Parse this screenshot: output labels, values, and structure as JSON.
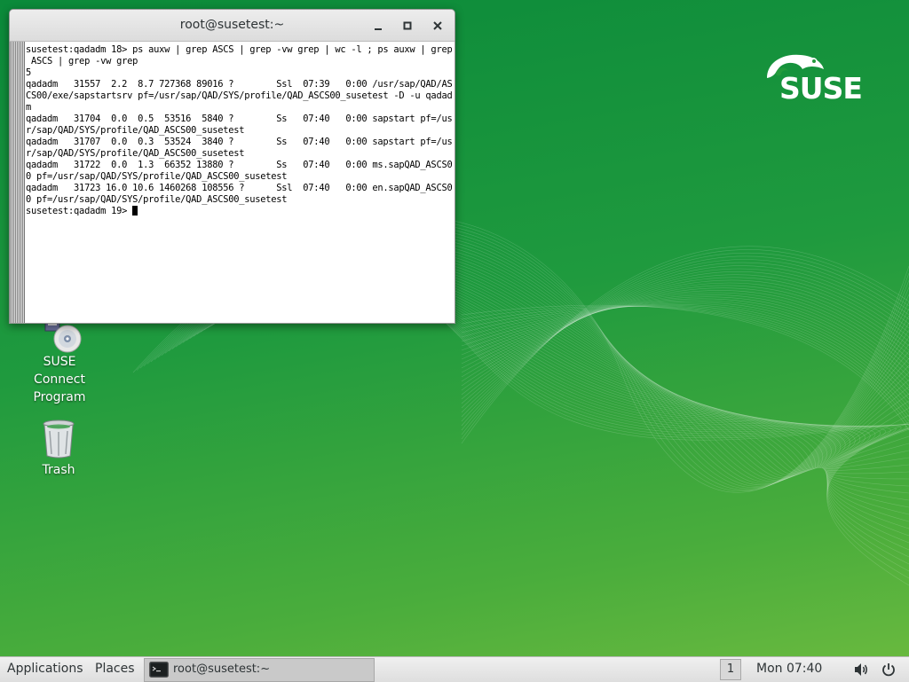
{
  "desktop": {
    "logo_text": "SUSE",
    "icons": [
      {
        "label_lines": [
          "SUSE",
          "Connect",
          "Program"
        ],
        "icon": "disk-icon"
      },
      {
        "label_lines": [
          "Trash"
        ],
        "icon": "trash-icon"
      }
    ]
  },
  "terminal": {
    "title": "root@susetest:~",
    "lines": [
      "susetest:qadadm 18> ps auxw | grep ASCS | grep -vw grep | wc -l ; ps auxw | grep",
      " ASCS | grep -vw grep",
      "5",
      "qadadm   31557  2.2  8.7 727368 89016 ?        Ssl  07:39   0:00 /usr/sap/QAD/AS",
      "CS00/exe/sapstartsrv pf=/usr/sap/QAD/SYS/profile/QAD_ASCS00_susetest -D -u qadad",
      "m",
      "qadadm   31704  0.0  0.5  53516  5840 ?        Ss   07:40   0:00 sapstart pf=/us",
      "r/sap/QAD/SYS/profile/QAD_ASCS00_susetest",
      "qadadm   31707  0.0  0.3  53524  3840 ?        Ss   07:40   0:00 sapstart pf=/us",
      "r/sap/QAD/SYS/profile/QAD_ASCS00_susetest",
      "qadadm   31722  0.0  1.3  66352 13880 ?        Ss   07:40   0:00 ms.sapQAD_ASCS0",
      "0 pf=/usr/sap/QAD/SYS/profile/QAD_ASCS00_susetest",
      "qadadm   31723 16.0 10.6 1460268 108556 ?      Ssl  07:40   0:00 en.sapQAD_ASCS0",
      "0 pf=/usr/sap/QAD/SYS/profile/QAD_ASCS00_susetest"
    ],
    "prompt": "susetest:qadadm 19> ",
    "buttons": {
      "minimize": "minimize-icon",
      "maximize": "maximize-icon",
      "close": "close-icon"
    }
  },
  "panel": {
    "applications": "Applications",
    "places": "Places",
    "task_label": "root@susetest:~",
    "workspace": "1",
    "clock": "Mon 07:40"
  }
}
